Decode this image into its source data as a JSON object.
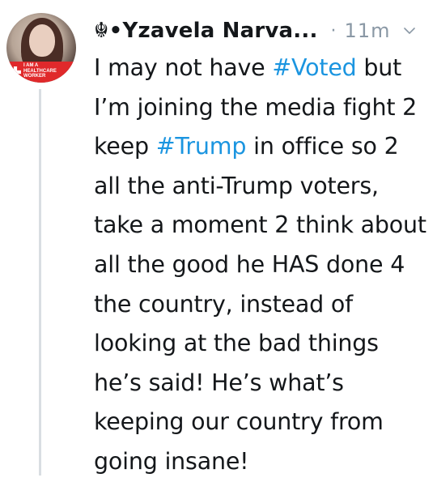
{
  "tweet": {
    "display_name": "☬•Yzavela Narva...",
    "separator": "·",
    "timestamp": "11m",
    "avatar_badge_text": "I AM A HEALTHCARE WORKER",
    "body_lines": [
      [
        {
          "text": "I may not have ",
          "type": "text"
        },
        {
          "text": "#Voted",
          "type": "hashtag"
        },
        {
          "text": " but",
          "type": "text"
        }
      ],
      [
        {
          "text": "I’m joining the media fight 2",
          "type": "text"
        }
      ],
      [
        {
          "text": "keep ",
          "type": "text"
        },
        {
          "text": "#Trump",
          "type": "hashtag"
        },
        {
          "text": " in office so 2",
          "type": "text"
        }
      ],
      [
        {
          "text": "all the anti-Trump voters,",
          "type": "text"
        }
      ],
      [
        {
          "text": "take a moment 2 think about",
          "type": "text"
        }
      ],
      [
        {
          "text": "all the good he HAS done 4",
          "type": "text"
        }
      ],
      [
        {
          "text": "the country, instead of",
          "type": "text"
        }
      ],
      [
        {
          "text": "looking at the bad things",
          "type": "text"
        }
      ],
      [
        {
          "text": "he’s said! He’s what’s",
          "type": "text"
        }
      ],
      [
        {
          "text": "keeping our country from",
          "type": "text"
        }
      ],
      [
        {
          "text": "going insane!",
          "type": "text"
        }
      ]
    ]
  },
  "icons": {
    "chevron": "chevron-down-icon",
    "avatar_cross": "medical-cross-icon"
  },
  "colors": {
    "text": "#14171a",
    "muted": "#8a98a5",
    "hashtag": "#1b95e0",
    "thread_line": "#d9dee2",
    "badge": "#e0292b"
  }
}
